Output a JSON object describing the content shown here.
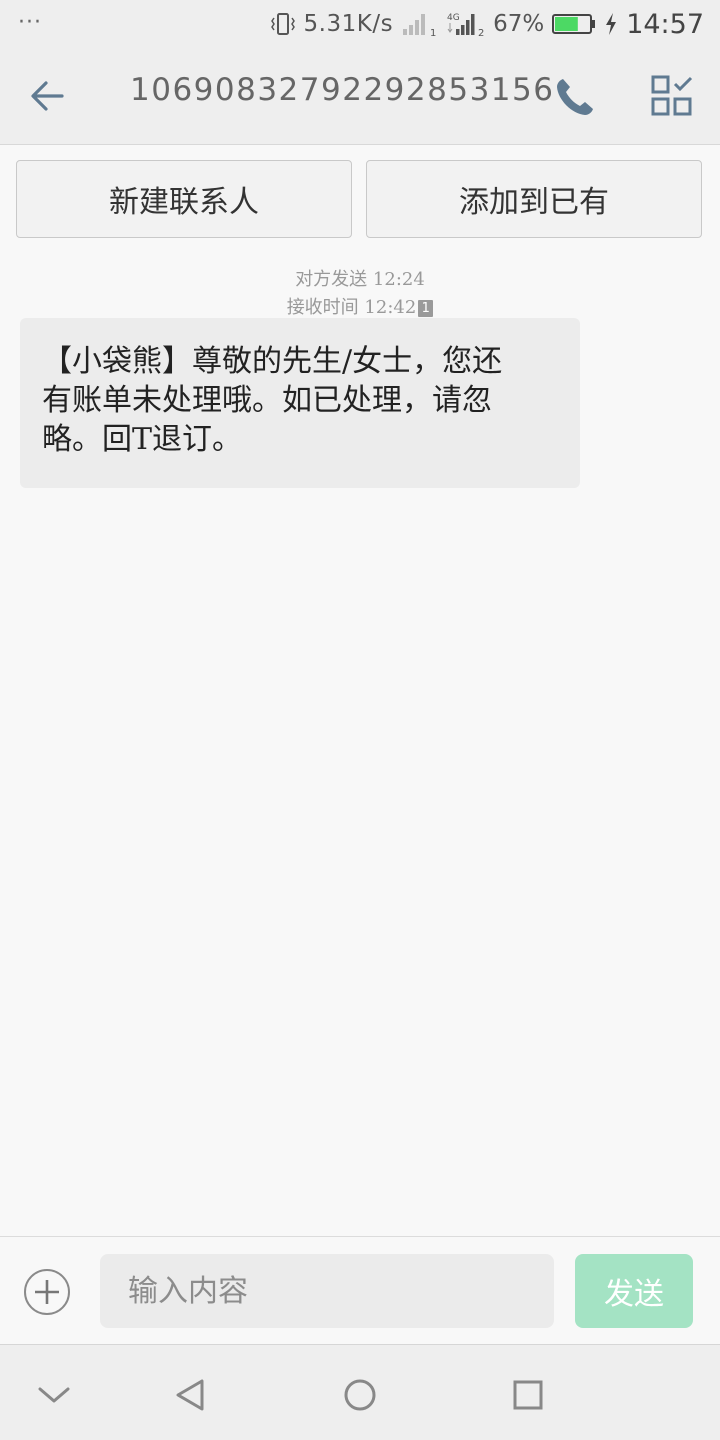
{
  "status_bar": {
    "dots": "···",
    "net_speed": "5.31K/s",
    "sim1_label": "1",
    "sim2_network": "4G",
    "sim2_label": "2",
    "battery_percent": "67%",
    "time": "14:57",
    "battery_level": 0.67,
    "battery_color": "#4cd964"
  },
  "header": {
    "title": "10690832792292853156",
    "icons": [
      "back-arrow-icon",
      "phone-icon",
      "grid-check-icon"
    ]
  },
  "contact_actions": {
    "new_contact_label": "新建联系人",
    "add_existing_label": "添加到已有"
  },
  "message": {
    "sent_label": "对方发送",
    "sent_time": "12:24",
    "received_label": "接收时间",
    "received_time": "12:42",
    "sim_badge": "1",
    "body_lines": [
      "【小袋熊】尊敬的先生/女士，您还",
      "有账单未处理哦。如已处理，请忽",
      "略。回T退订。"
    ]
  },
  "composer": {
    "placeholder": "输入内容",
    "send_label": "发送",
    "send_color": "#a4e3c4",
    "icons": [
      "plus-icon"
    ]
  },
  "nav_bar": {
    "icons": [
      "chevron-down-icon",
      "triangle-back-icon",
      "circle-home-icon",
      "square-recent-icon"
    ]
  }
}
